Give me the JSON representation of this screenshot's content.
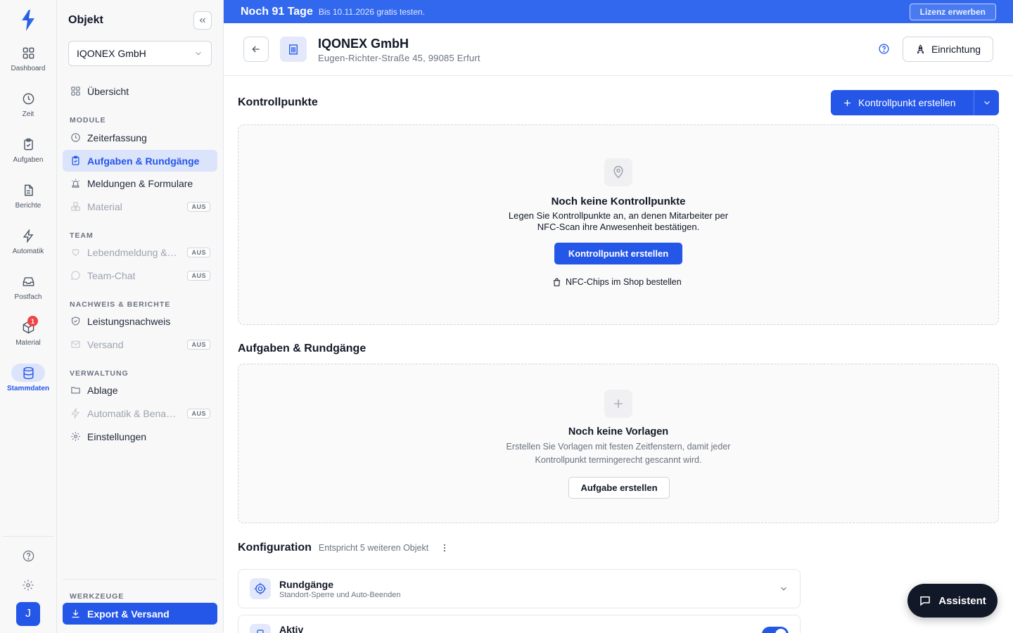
{
  "rail": {
    "items": [
      {
        "label": "Dashboard",
        "icon": "grid-icon"
      },
      {
        "label": "Zeit",
        "icon": "clock-icon"
      },
      {
        "label": "Aufgaben",
        "icon": "clipboard-check-icon"
      },
      {
        "label": "Berichte",
        "icon": "document-icon"
      },
      {
        "label": "Automatik",
        "icon": "bolt-icon"
      },
      {
        "label": "Postfach",
        "icon": "inbox-icon"
      },
      {
        "label": "Material",
        "icon": "box-icon",
        "badge": "1"
      },
      {
        "label": "Stammdaten",
        "icon": "database-icon",
        "active": true
      }
    ],
    "avatar": "J"
  },
  "sidebar": {
    "title": "Objekt",
    "select_value": "IQONEX GmbH",
    "overview": "Übersicht",
    "sections": {
      "module": "MODULE",
      "team": "TEAM",
      "nachweis": "NACHWEIS & BERICHTE",
      "verwaltung": "VERWALTUNG",
      "werkzeuge": "WERKZEUGE"
    },
    "items": {
      "zeiterfassung": "Zeiterfassung",
      "aufgaben": "Aufgaben & Rundgänge",
      "meldungen": "Meldungen & Formulare",
      "material": "Material",
      "lebendmeldung": "Lebendmeldung & Alleinarbeit",
      "teamchat": "Team-Chat",
      "leistungsnachweis": "Leistungsnachweis",
      "versand": "Versand",
      "ablage": "Ablage",
      "automatik": "Automatik & Benachrichtigungen",
      "einstellungen": "Einstellungen"
    },
    "off_badge": "AUS",
    "export": "Export & Versand"
  },
  "trial": {
    "days": "Noch 91 Tage",
    "text": "Bis 10.11.2026 gratis testen.",
    "license_button": "Lizenz erwerben"
  },
  "header": {
    "name": "IQONEX GmbH",
    "address": "Eugen-Richter-Straße 45, 99085 Erfurt",
    "setup_button": "Einrichtung"
  },
  "kontrollpunkte": {
    "title": "Kontrollpunkte",
    "create_button": "Kontrollpunkt erstellen",
    "empty_title": "Noch keine Kontrollpunkte",
    "empty_text": "Legen Sie Kontrollpunkte an, an denen Mitarbeiter per NFC-Scan ihre Anwesenheit bestätigen.",
    "empty_button": "Kontrollpunkt erstellen",
    "shop_link": "NFC-Chips im Shop bestellen"
  },
  "aufgaben": {
    "title": "Aufgaben & Rundgänge",
    "empty_title": "Noch keine Vorlagen",
    "empty_text": "Erstellen Sie Vorlagen mit festen Zeitfenstern, damit jeder Kontrollpunkt termingerecht gescannt wird.",
    "empty_button": "Aufgabe erstellen"
  },
  "konfiguration": {
    "title": "Konfiguration",
    "subtitle": "Entspricht 5 weiteren Objekt",
    "cards": [
      {
        "title": "Rundgänge",
        "subtitle": "Standort-Sperre und Auto-Beenden"
      },
      {
        "title": "Aktiv",
        "toggle_on": true
      }
    ]
  },
  "assistant_button": "Assistent",
  "colors": {
    "accent": "#2456e8",
    "trial_banner": "#3168ee",
    "badge": "#ef4444",
    "assistant": "#111827"
  }
}
